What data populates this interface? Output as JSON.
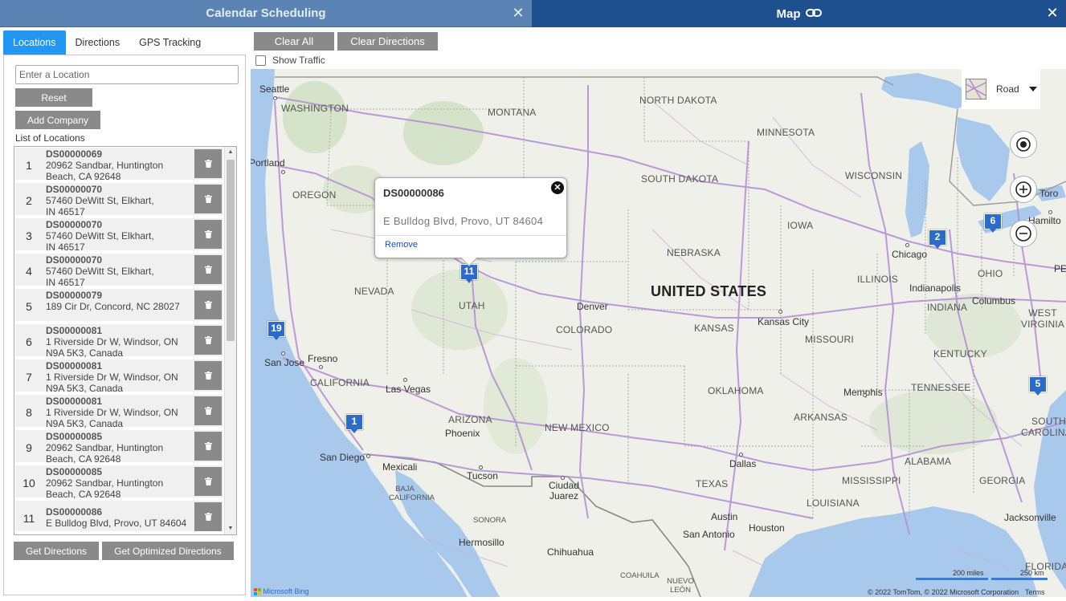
{
  "left_title": "Calendar Scheduling",
  "right_title": "Map",
  "tabs": [
    "Locations",
    "Directions",
    "GPS Tracking"
  ],
  "location_input": {
    "placeholder": "Enter a Location",
    "value": ""
  },
  "buttons": {
    "reset": "Reset",
    "add_company": "Add Company",
    "get_directions": "Get Directions",
    "get_optimized": "Get Optimized Directions",
    "clear_all": "Clear All",
    "clear_directions": "Clear Directions"
  },
  "list_title": "List of Locations",
  "locations": [
    {
      "num": "1",
      "id": "DS00000069",
      "addr": "20962 Sandbar, Huntington Beach, CA 92648"
    },
    {
      "num": "2",
      "id": "DS00000070",
      "addr": "57460 DeWitt St, Elkhart, IN 46517"
    },
    {
      "num": "3",
      "id": "DS00000070",
      "addr": "57460 DeWitt St, Elkhart, IN 46517"
    },
    {
      "num": "4",
      "id": "DS00000070",
      "addr": "57460 DeWitt St, Elkhart, IN 46517"
    },
    {
      "num": "5",
      "id": "DS00000079",
      "addr": "189 Cir Dr, Concord, NC 28027"
    },
    {
      "num": "6",
      "id": "DS00000081",
      "addr": "1 Riverside Dr W, Windsor, ON N9A 5K3, Canada"
    },
    {
      "num": "7",
      "id": "DS00000081",
      "addr": "1 Riverside Dr W, Windsor, ON N9A 5K3, Canada"
    },
    {
      "num": "8",
      "id": "DS00000081",
      "addr": "1 Riverside Dr W, Windsor, ON N9A 5K3, Canada"
    },
    {
      "num": "9",
      "id": "DS00000085",
      "addr": "20962 Sandbar, Huntington Beach, CA 92648"
    },
    {
      "num": "10",
      "id": "DS00000085",
      "addr": "20962 Sandbar, Huntington Beach, CA 92648"
    },
    {
      "num": "11",
      "id": "DS00000086",
      "addr": "E Bulldog Blvd, Provo, UT 84604"
    }
  ],
  "show_traffic": {
    "label": "Show Traffic",
    "checked": false
  },
  "popup": {
    "title": "DS00000086",
    "address": "E Bulldog Blvd, Provo, UT 84604",
    "remove": "Remove"
  },
  "map_style": "Road",
  "pins": [
    "1",
    "2",
    "5",
    "6",
    "11",
    "19"
  ],
  "map_labels": {
    "states": [
      "WASHINGTON",
      "MONTANA",
      "NORTH DAKOTA",
      "MINNESOTA",
      "SOUTH DAKOTA",
      "OREGON",
      "WISCONSIN",
      "IOWA",
      "NEBRASKA",
      "NEVADA",
      "UTAH",
      "ILLINOIS",
      "INDIANA",
      "OHIO",
      "WEST VIRGINIA",
      "COLORADO",
      "KANSAS",
      "MISSOURI",
      "KENTUCKY",
      "CALIFORNIA",
      "OKLAHOMA",
      "TENNESSEE",
      "ARIZONA",
      "NEW MEXICO",
      "ARKANSAS",
      "SOUTH CAROLINA",
      "ALABAMA",
      "TEXAS",
      "MISSISSIPPI",
      "GEORGIA",
      "LOUISIANA",
      "FLORIDA",
      "BAJA CALIFORNIA",
      "SONORA",
      "COAHUILA",
      "NUEVO LEÓN"
    ],
    "cities": [
      "Seattle",
      "Portland",
      "Toro",
      "Hamilto",
      "Chicago",
      "Indianapolis",
      "Columbus",
      "Denver",
      "Kansas City",
      "San Jose",
      "Fresno",
      "Las Vegas",
      "Memphis",
      "Phoenix",
      "San Diego",
      "Mexicali",
      "Tucson",
      "Ciudad Juarez",
      "Dallas",
      "Austin",
      "San Antonio",
      "Houston",
      "Jacksonville",
      "Hermosillo",
      "Chihuahua",
      "PE"
    ],
    "country": "UNITED STATES"
  },
  "scale": {
    "miles": "200 miles",
    "km": "250 km"
  },
  "attribution": "© 2022 TomTom, © 2022 Microsoft Corporation",
  "terms": "Terms",
  "provider": "Microsoft Bing",
  "colors": {
    "accent": "#2196f3",
    "button_gray": "#8a8a8a",
    "title_left": "#5b84b4",
    "title_right": "#1e4f8f",
    "pin": "#2d6bc8",
    "water": "#a8c8ec",
    "road": "#b38bd6"
  }
}
